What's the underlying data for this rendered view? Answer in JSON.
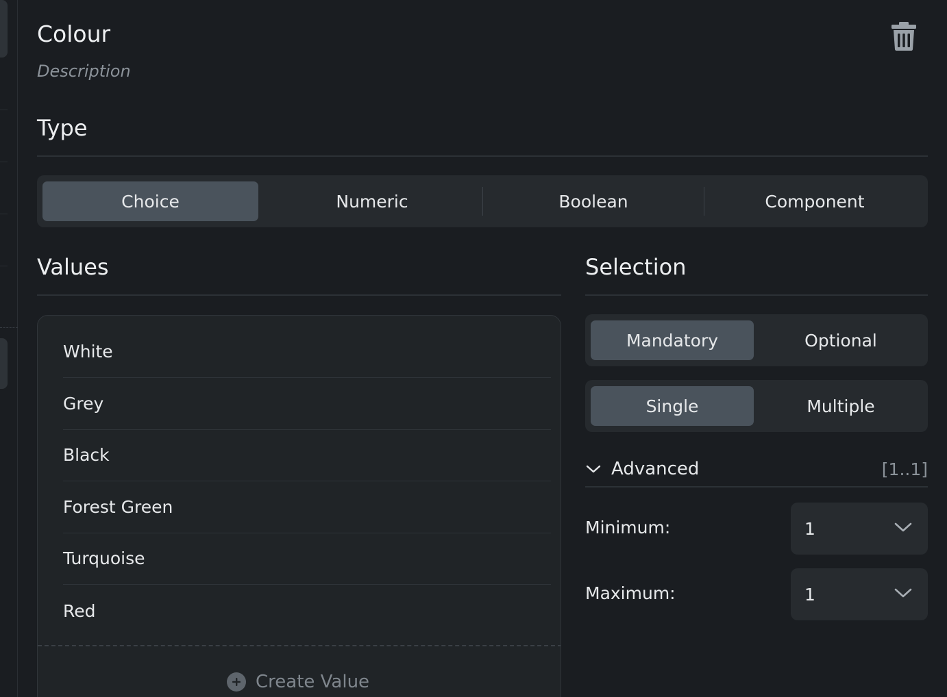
{
  "header": {
    "title": "Colour",
    "description": "Description"
  },
  "type_section": {
    "title": "Type",
    "options": [
      {
        "label": "Choice",
        "active": true
      },
      {
        "label": "Numeric",
        "active": false
      },
      {
        "label": "Boolean",
        "active": false
      },
      {
        "label": "Component",
        "active": false
      }
    ]
  },
  "values_section": {
    "title": "Values",
    "items": [
      "White",
      "Grey",
      "Black",
      "Forest Green",
      "Turquoise",
      "Red"
    ],
    "create_label": "Create Value"
  },
  "selection_section": {
    "title": "Selection",
    "requirement": {
      "options": [
        {
          "label": "Mandatory",
          "active": true
        },
        {
          "label": "Optional",
          "active": false
        }
      ]
    },
    "cardinality": {
      "options": [
        {
          "label": "Single",
          "active": true
        },
        {
          "label": "Multiple",
          "active": false
        }
      ]
    },
    "advanced": {
      "label": "Advanced",
      "range": "[1..1]",
      "expanded": true
    },
    "minimum": {
      "label": "Minimum:",
      "value": "1"
    },
    "maximum": {
      "label": "Maximum:",
      "value": "1"
    }
  },
  "icons": {
    "trash": "trash-icon",
    "chevron": "chevron-down-icon",
    "plus": "plus-circle-icon"
  },
  "colors": {
    "background": "#1a1d21",
    "segment_bg": "#262a2e",
    "segment_active": "#4a535c",
    "text": "#e6e8ea",
    "muted": "#8b9299"
  }
}
